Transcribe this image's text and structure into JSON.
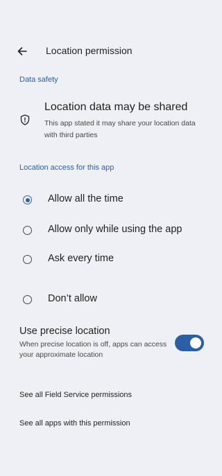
{
  "appbar": {
    "title": "Location permission",
    "back_icon": "arrow-back-icon"
  },
  "data_safety": {
    "header": "Data safety",
    "icon": "shield-icon",
    "title": "Location data may be shared",
    "description": "This app stated it may share your location data with third parties"
  },
  "location_access": {
    "header": "Location access for this app",
    "options": [
      {
        "label": "Allow all the time",
        "selected": true
      },
      {
        "label": "Allow only while using the app",
        "selected": false
      },
      {
        "label": "Ask every time",
        "selected": false
      },
      {
        "label": "Don’t allow",
        "selected": false
      }
    ]
  },
  "precise_location": {
    "title": "Use precise location",
    "description": "When precise location is off, apps can access your approximate location",
    "enabled": true
  },
  "links": [
    {
      "label": "See all Field Service permissions"
    },
    {
      "label": "See all apps with this permission"
    }
  ],
  "colors": {
    "background": "#EEF0F5",
    "accent": "#2A5FA7",
    "text_primary": "#1F1F1F",
    "text_secondary": "#474747"
  }
}
